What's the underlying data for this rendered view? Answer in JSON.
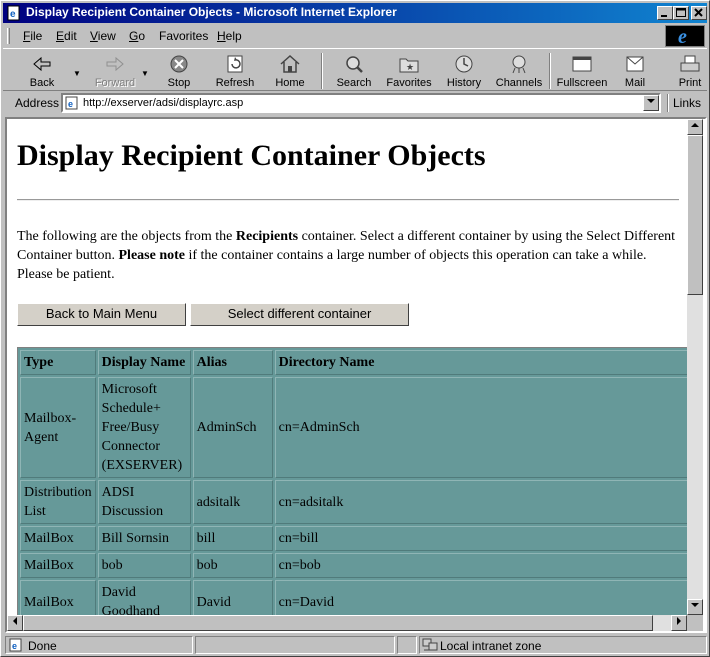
{
  "window": {
    "title": "Display Recipient Container Objects - Microsoft Internet Explorer",
    "minimize_label": "_",
    "maximize_label": "□",
    "close_label": "×"
  },
  "menu": {
    "items": [
      {
        "key": "F",
        "rest": "ile"
      },
      {
        "key": "E",
        "rest": "dit"
      },
      {
        "key": "V",
        "rest": "iew"
      },
      {
        "key": "G",
        "rest": "o"
      },
      {
        "key": "",
        "rest": "Favorites",
        "pre": "F",
        "underline_index": 2
      },
      {
        "key": "H",
        "rest": "elp"
      }
    ]
  },
  "toolbar": {
    "back": "Back",
    "forward": "Forward",
    "stop": "Stop",
    "refresh": "Refresh",
    "home": "Home",
    "search": "Search",
    "favorites": "Favorites",
    "history": "History",
    "channels": "Channels",
    "fullscreen": "Fullscreen",
    "mail": "Mail",
    "print": "Print"
  },
  "address": {
    "label": "Address",
    "url": "http://exserver/adsi/displayrc.asp",
    "links": "Links"
  },
  "page": {
    "heading": "Display Recipient Container Objects",
    "intro_1": "The following are the objects from the ",
    "intro_bold_1": "Recipients",
    "intro_2": " container. Select a different container by using the Select Different Container button. ",
    "intro_bold_2": "Please note",
    "intro_3": " if the container contains a large number of objects this operation can take a while. Please be patient.",
    "back_button": "Back to Main Menu",
    "select_button": "Select different container"
  },
  "table": {
    "headers": [
      "Type",
      "Display Name",
      "Alias",
      "Directory Name"
    ],
    "rows": [
      [
        "Mailbox-Agent",
        "Microsoft Schedule+ Free/Busy Connector (EXSERVER)",
        "AdminSch",
        "cn=AdminSch"
      ],
      [
        "Distribution List",
        "ADSI Discussion",
        "adsitalk",
        "cn=adsitalk"
      ],
      [
        "MailBox",
        "Bill Sornsin",
        "bill",
        "cn=bill"
      ],
      [
        "MailBox",
        "bob",
        "bob",
        "cn=bob"
      ],
      [
        "MailBox",
        "David Goodhand",
        "David",
        "cn=David"
      ]
    ]
  },
  "status": {
    "text": "Done",
    "zone": "Local intranet zone"
  }
}
